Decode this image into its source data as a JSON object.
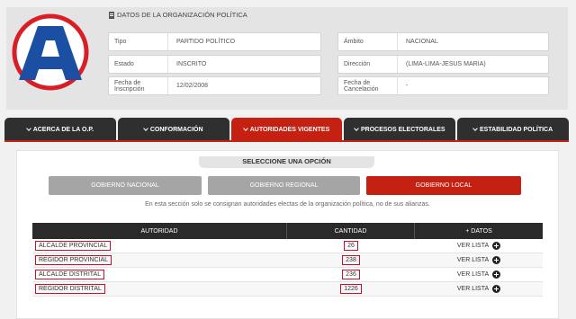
{
  "header": {
    "section_title": "DATOS DE LA ORGANIZACIÓN POLÍTICA",
    "fields": {
      "tipo": {
        "label": "Tipo",
        "value": "PARTIDO POLÍTICO"
      },
      "estado": {
        "label": "Estado",
        "value": "INSCRITO"
      },
      "fecha_inscripcion": {
        "label": "Fecha de Inscripción",
        "value": "12/02/2008"
      },
      "ambito": {
        "label": "Ámbito",
        "value": "NACIONAL"
      },
      "direccion": {
        "label": "Dirección",
        "value": "(LIMA-LIMA-JESUS MARIA)"
      },
      "fecha_cancelacion": {
        "label": "Fecha de Cancelación",
        "value": "-"
      }
    }
  },
  "tabs": [
    {
      "label": "ACERCA DE LA O.P."
    },
    {
      "label": "CONFORMACIÓN"
    },
    {
      "label": "AUTORIDADES VIGENTES"
    },
    {
      "label": "PROCESOS ELECTORALES"
    },
    {
      "label": "ESTABILIDAD POLÍTICA"
    }
  ],
  "active_tab": "AUTORIDADES VIGENTES",
  "options": {
    "title": "SELECCIONE UNA OPCIÓN",
    "nacional": "GOBIERNO NACIONAL",
    "regional": "GOBIERNO REGIONAL",
    "local": "GOBIERNO LOCAL",
    "selected": "GOBIERNO LOCAL"
  },
  "note": "En esta sección solo se consignan autoridades electas de la organización política, no de sus alianzas.",
  "table": {
    "headers": {
      "autoridad": "AUTORIDAD",
      "cantidad": "CANTIDAD",
      "datos": "+ DATOS"
    },
    "rows": [
      {
        "autoridad": "ALCALDE PROVINCIAL",
        "cantidad": "26",
        "link": "VER LISTA"
      },
      {
        "autoridad": "REGIDOR PROVINCIAL",
        "cantidad": "238",
        "link": "VER LISTA"
      },
      {
        "autoridad": "ALCALDE DISTRITAL",
        "cantidad": "236",
        "link": "VER LISTA"
      },
      {
        "autoridad": "REGIDOR DISTRITAL",
        "cantidad": "1226",
        "link": "VER LISTA"
      }
    ]
  },
  "colors": {
    "accent": "#c52112",
    "dark": "#2f2f2f",
    "logo_blue": "#1a4fa3",
    "highlight": "#c8102e"
  }
}
